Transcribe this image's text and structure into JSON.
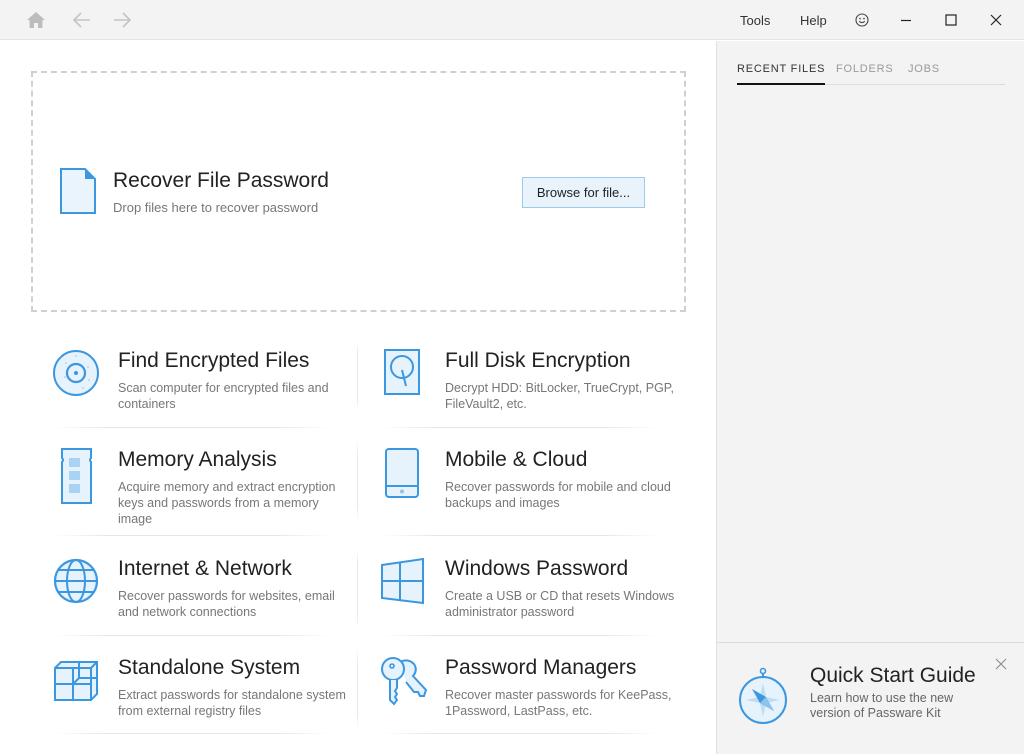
{
  "titlebar": {
    "menu_tools": "Tools",
    "menu_help": "Help"
  },
  "dropzone": {
    "title": "Recover File Password",
    "subtitle": "Drop files here to recover password",
    "browse_label": "Browse for file..."
  },
  "tiles": [
    {
      "title": "Find Encrypted Files",
      "desc": "Scan computer for encrypted files and containers",
      "icon": "disc-scan-icon"
    },
    {
      "title": "Full Disk Encryption",
      "desc": "Decrypt HDD: BitLocker, TrueCrypt, PGP, FileVault2, etc.",
      "icon": "hard-disk-icon"
    },
    {
      "title": "Memory Analysis",
      "desc": "Acquire memory and extract encryption keys and passwords from a memory image",
      "icon": "memory-module-icon"
    },
    {
      "title": "Mobile & Cloud",
      "desc": "Recover passwords for mobile and cloud backups and images",
      "icon": "mobile-device-icon"
    },
    {
      "title": "Internet & Network",
      "desc": "Recover passwords for websites, email and network connections",
      "icon": "globe-icon"
    },
    {
      "title": "Windows Password",
      "desc": "Create a USB or CD that resets Windows administrator password",
      "icon": "windows-logo-icon"
    },
    {
      "title": "Standalone System",
      "desc": "Extract passwords for standalone system from external registry files",
      "icon": "cubes-icon"
    },
    {
      "title": "Password Managers",
      "desc": "Recover master passwords for KeePass, 1Password, LastPass, etc.",
      "icon": "keys-icon"
    }
  ],
  "sidebar": {
    "tabs": [
      {
        "label": "RECENT FILES",
        "active": true
      },
      {
        "label": "FOLDERS",
        "active": false
      },
      {
        "label": "JOBS",
        "active": false
      }
    ],
    "quick_start": {
      "title": "Quick Start Guide",
      "desc": "Learn how to use the new version of Passware Kit"
    }
  },
  "colors": {
    "accent": "#3b97e0",
    "accent_fill": "#e6f2fc"
  }
}
